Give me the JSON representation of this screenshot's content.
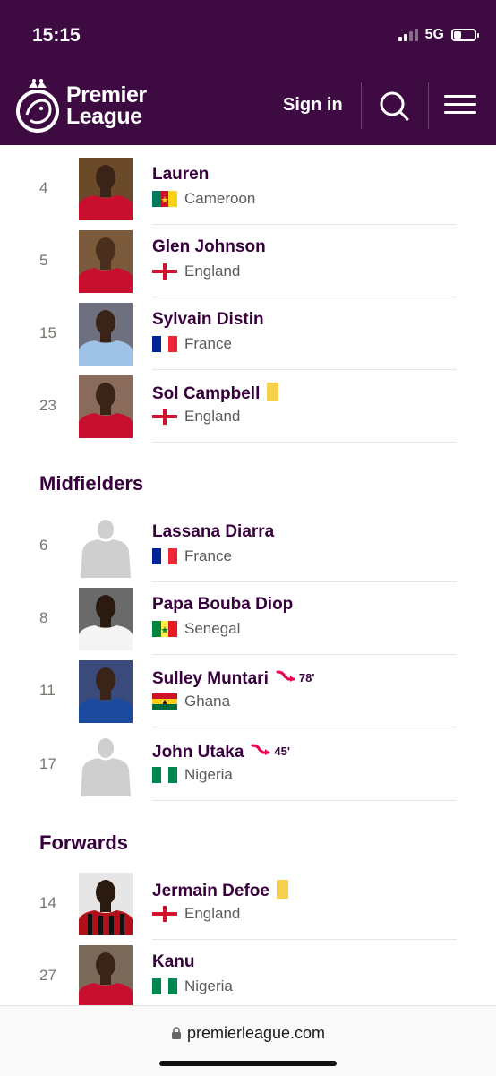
{
  "status": {
    "time": "15:15",
    "network": "5G",
    "battery_level": 0.35
  },
  "header": {
    "logo_line1": "Premier",
    "logo_line2": "League",
    "signin_label": "Sign in"
  },
  "sections": [
    {
      "title": ""
    },
    {
      "title": "Midfielders"
    },
    {
      "title": "Forwards"
    }
  ],
  "players": [
    {
      "number": "4",
      "name": "Lauren",
      "nationality": "Cameroon",
      "flag": "cameroon",
      "card": "",
      "sub_minute": ""
    },
    {
      "number": "5",
      "name": "Glen Johnson",
      "nationality": "England",
      "flag": "england",
      "card": "",
      "sub_minute": ""
    },
    {
      "number": "15",
      "name": "Sylvain Distin",
      "nationality": "France",
      "flag": "france",
      "card": "",
      "sub_minute": ""
    },
    {
      "number": "23",
      "name": "Sol Campbell",
      "nationality": "England",
      "flag": "england",
      "card": "yellow",
      "sub_minute": ""
    },
    {
      "number": "6",
      "name": "Lassana Diarra",
      "nationality": "France",
      "flag": "france",
      "card": "",
      "sub_minute": ""
    },
    {
      "number": "8",
      "name": "Papa Bouba Diop",
      "nationality": "Senegal",
      "flag": "senegal",
      "card": "",
      "sub_minute": ""
    },
    {
      "number": "11",
      "name": "Sulley Muntari",
      "nationality": "Ghana",
      "flag": "ghana",
      "card": "",
      "sub_minute": "78'"
    },
    {
      "number": "17",
      "name": "John Utaka",
      "nationality": "Nigeria",
      "flag": "nigeria",
      "card": "",
      "sub_minute": "45'"
    },
    {
      "number": "14",
      "name": "Jermain Defoe",
      "nationality": "England",
      "flag": "england",
      "card": "yellow",
      "sub_minute": ""
    },
    {
      "number": "27",
      "name": "Kanu",
      "nationality": "Nigeria",
      "flag": "nigeria",
      "card": "",
      "sub_minute": ""
    }
  ],
  "browser": {
    "url": "premierleague.com"
  },
  "colors": {
    "brand": "#3d0a42",
    "yellow_card": "#f7d14c",
    "sub_arrow": "#e90052"
  }
}
